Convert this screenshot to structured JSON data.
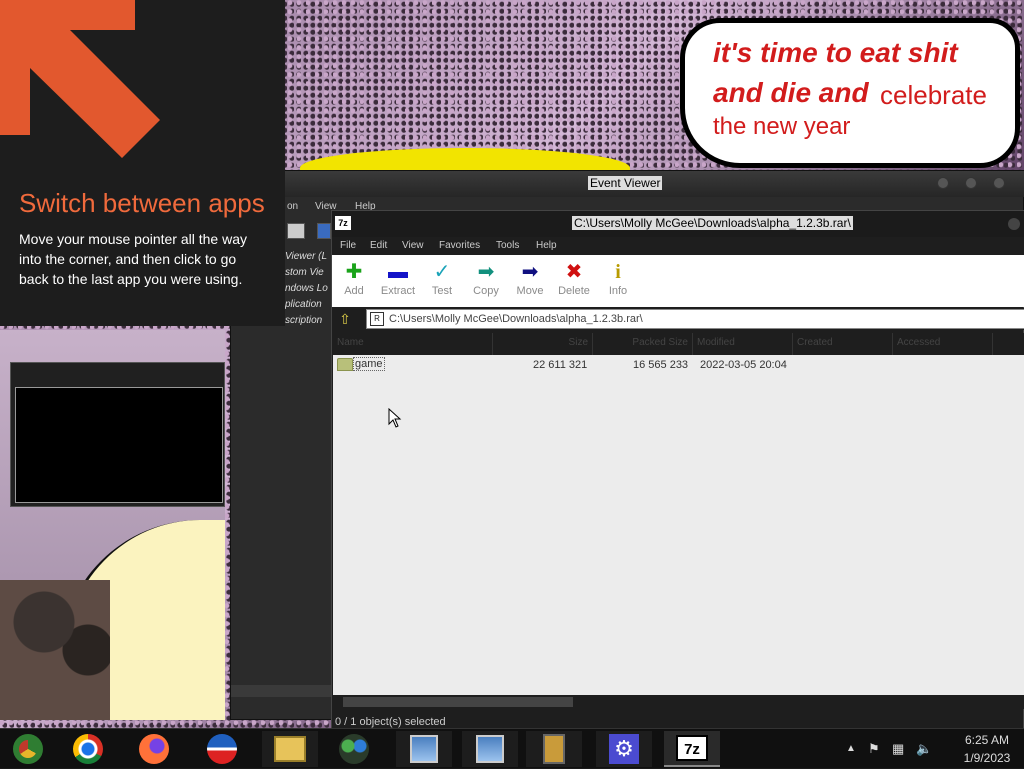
{
  "switch_panel": {
    "title": "Switch between apps",
    "description": "Move your mouse pointer all the way into the corner, and then click to go back to the last app you were using."
  },
  "wallpaper_bubble": {
    "line1": "it's time to eat shit",
    "line2": "and die and",
    "line2_rest": "celebrate",
    "line3": "the new year"
  },
  "event_viewer": {
    "title": "Event Viewer",
    "menu": [
      "on",
      "View",
      "Help"
    ],
    "tree": [
      "Viewer (L",
      "stom Vie",
      "ndows Lo",
      "plication",
      "scription"
    ]
  },
  "zip": {
    "title": "C:\\Users\\Molly McGee\\Downloads\\alpha_1.2.3b.rar\\",
    "menu": [
      "File",
      "Edit",
      "View",
      "Favorites",
      "Tools",
      "Help"
    ],
    "toolbar": [
      {
        "label": "Add",
        "icon": "add-icon",
        "color": "#1aa31a"
      },
      {
        "label": "Extract",
        "icon": "extract-icon",
        "color": "#1414c8"
      },
      {
        "label": "Test",
        "icon": "test-icon",
        "color": "#1aa3b8"
      },
      {
        "label": "Copy",
        "icon": "copy-icon",
        "color": "#12907e"
      },
      {
        "label": "Move",
        "icon": "move-icon",
        "color": "#101080"
      },
      {
        "label": "Delete",
        "icon": "delete-icon",
        "color": "#d01010"
      },
      {
        "label": "Info",
        "icon": "info-icon",
        "color": "#b89b00"
      }
    ],
    "address": "C:\\Users\\Molly McGee\\Downloads\\alpha_1.2.3b.rar\\",
    "columns": [
      "Name",
      "Size",
      "Packed Size",
      "Modified",
      "Created",
      "Accessed"
    ],
    "rows": [
      {
        "name": "game",
        "size": "22 611 321",
        "packed": "16 565 233",
        "modified": "2022-03-05 20:04"
      }
    ],
    "status": "0 / 1 object(s) selected"
  },
  "taskbar": {
    "apps": [
      {
        "name": "chrome-canary",
        "color": "#2f7d32"
      },
      {
        "name": "chrome",
        "color": "#d93025"
      },
      {
        "name": "firefox",
        "color": "#ff7139"
      },
      {
        "name": "obama-campaign",
        "color": "#1f5fbf"
      },
      {
        "name": "file-explorer",
        "color": "#e7c35a"
      },
      {
        "name": "network-people",
        "color": "#4caf50"
      },
      {
        "name": "remote-desktop-1",
        "color": "#4a7fbf"
      },
      {
        "name": "remote-desktop-2",
        "color": "#4a7fbf"
      },
      {
        "name": "archive-manager",
        "color": "#c99b3a"
      },
      {
        "name": "settings",
        "color": "#4b4bd0"
      },
      {
        "name": "7zip",
        "color": "#ffffff"
      }
    ],
    "time": "6:25 AM",
    "date": "1/9/2023"
  }
}
